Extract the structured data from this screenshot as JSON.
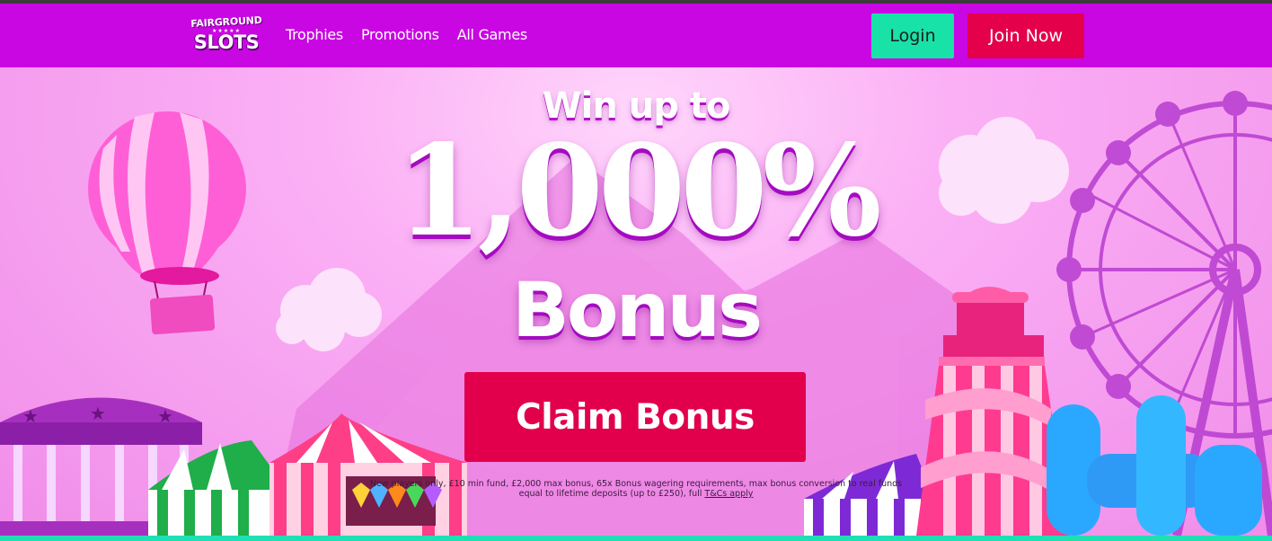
{
  "brand": {
    "logo_top": "FAIRGROUND",
    "logo_stars": "★★★★★",
    "logo_bottom": "SLOTS"
  },
  "nav": {
    "links": [
      "Trophies",
      "Promotions",
      "All Games"
    ],
    "login_label": "Login",
    "join_label": "Join Now"
  },
  "hero": {
    "line1": "Win up to",
    "line2": "1,000%",
    "line3": "Bonus",
    "cta_label": "Claim Bonus",
    "terms_text": "New players only, £10 min fund, £2,000 max bonus, 65x Bonus wagering requirements, max bonus conversion to real funds equal to lifetime deposits (up to £250), full",
    "terms_link": "T&Cs apply"
  },
  "colors": {
    "nav_bg": "#c907e2",
    "login_bg": "#19e2a9",
    "join_bg": "#e5004c",
    "cta_bg": "#e2004c",
    "accent_bottom": "#1ee0b4"
  },
  "icons": [
    "hot-air-balloon-icon",
    "ferris-wheel-icon",
    "carousel-icon",
    "tent-icon",
    "helter-skelter-icon",
    "cloud-icon",
    "gems-icon",
    "inflatable-castle-icon"
  ]
}
